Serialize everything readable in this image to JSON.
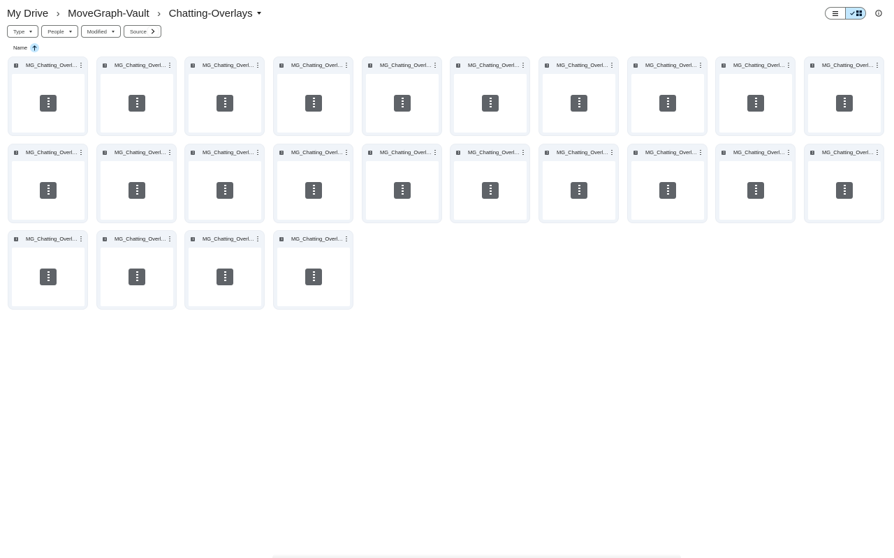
{
  "breadcrumb": {
    "items": [
      "My Drive",
      "MoveGraph-Vault",
      "Chatting-Overlays"
    ],
    "separator": "›"
  },
  "view": {
    "list_icon": "list-icon",
    "grid_icon": "grid-icon",
    "active": "grid",
    "info_icon": "info-icon"
  },
  "filters": [
    "Type",
    "People",
    "Modified",
    "Source"
  ],
  "sort": {
    "label": "Name",
    "direction": "ascending"
  },
  "colors": {
    "accent": "#c2e7ff",
    "card_bg": "#f0f4f9",
    "icon": "#5f6368"
  },
  "files": [
    {
      "name": "MG_Chatting_Overla..."
    },
    {
      "name": "MG_Chatting_Overla..."
    },
    {
      "name": "MG_Chatting_Overla..."
    },
    {
      "name": "MG_Chatting_Overla..."
    },
    {
      "name": "MG_Chatting_Overla..."
    },
    {
      "name": "MG_Chatting_Overla..."
    },
    {
      "name": "MG_Chatting_Overla..."
    },
    {
      "name": "MG_Chatting_Overla..."
    },
    {
      "name": "MG_Chatting_Overla..."
    },
    {
      "name": "MG_Chatting_Overla..."
    },
    {
      "name": "MG_Chatting_Overla..."
    },
    {
      "name": "MG_Chatting_Overla..."
    },
    {
      "name": "MG_Chatting_Overla..."
    },
    {
      "name": "MG_Chatting_Overla..."
    },
    {
      "name": "MG_Chatting_Overla..."
    },
    {
      "name": "MG_Chatting_Overla..."
    },
    {
      "name": "MG_Chatting_Overla..."
    },
    {
      "name": "MG_Chatting_Overla..."
    },
    {
      "name": "MG_Chatting_Overla..."
    },
    {
      "name": "MG_Chatting_Overla..."
    },
    {
      "name": "MG_Chatting_Overla..."
    },
    {
      "name": "MG_Chatting_Overla..."
    },
    {
      "name": "MG_Chatting_Overla..."
    },
    {
      "name": "MG_Chatting_Overla..."
    }
  ]
}
